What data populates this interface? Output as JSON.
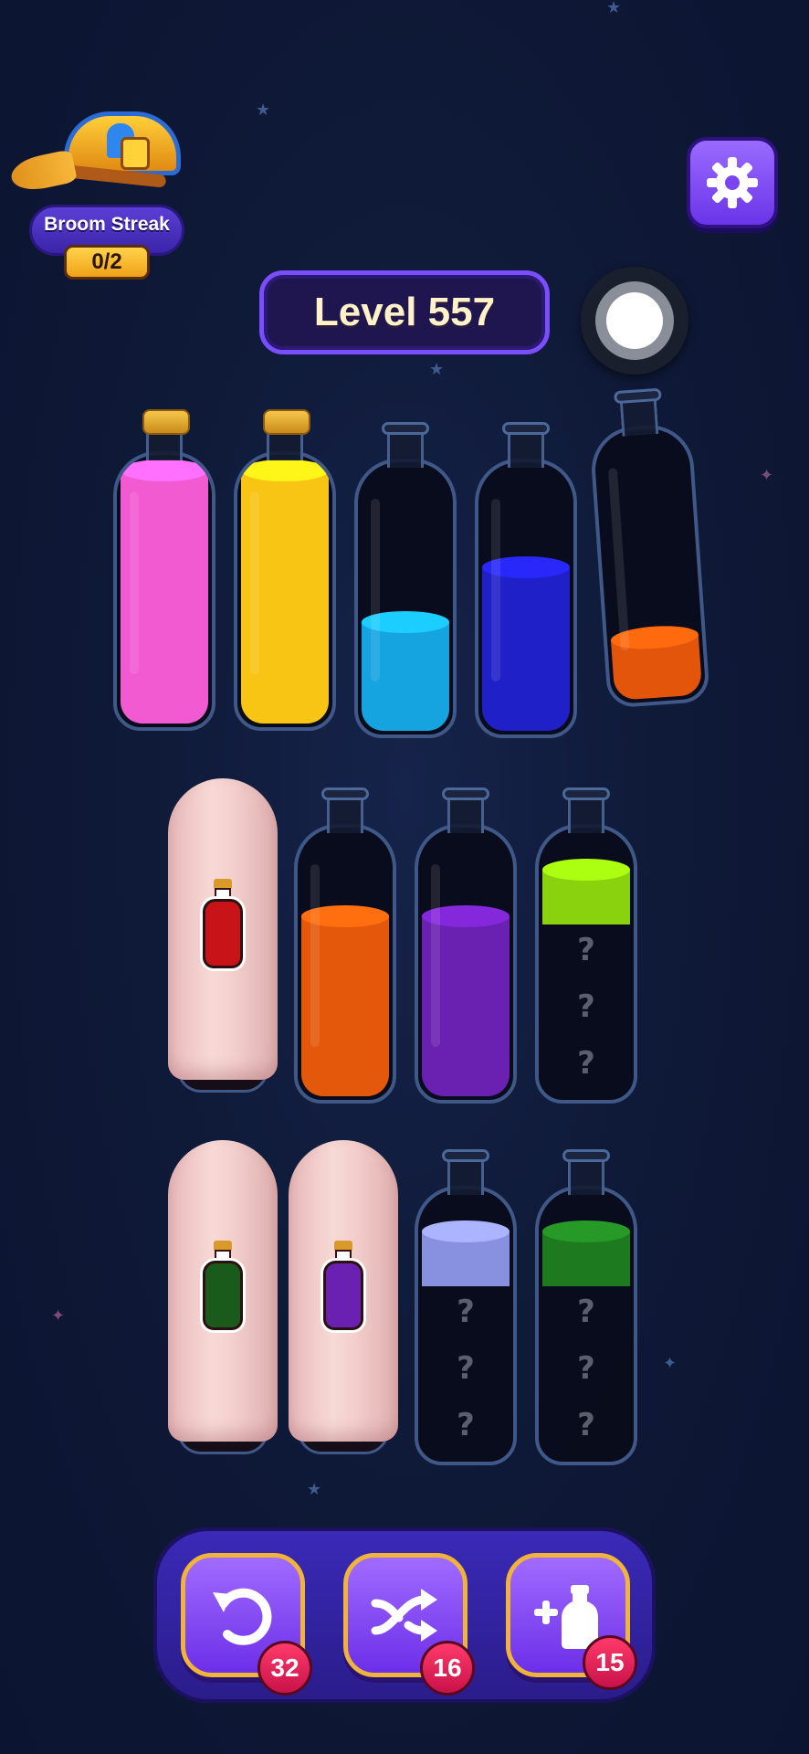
{
  "streak": {
    "label": "Broom Streak",
    "count": "0/2"
  },
  "level": {
    "label": "Level 557"
  },
  "icons": {
    "settings": "gear-icon",
    "record": "record-button",
    "undo": "undo-icon",
    "shuffle": "shuffle-icon",
    "add_bottle": "add-bottle-icon"
  },
  "bottles_row1": [
    {
      "color": "#f25ad2",
      "level": 0.93,
      "corked": true
    },
    {
      "color": "#f9c514",
      "level": 0.93,
      "corked": true
    },
    {
      "color": "#16a4e0",
      "level": 0.4,
      "corked": false
    },
    {
      "color": "#2020c8",
      "level": 0.6,
      "corked": false
    },
    {
      "color": "#e4550c",
      "level": 0.2,
      "corked": false
    }
  ],
  "bottles_row2": [
    {
      "covered": true,
      "hint_color": "#c81418"
    },
    {
      "color": "#e4580c",
      "level": 0.66,
      "corked": false
    },
    {
      "color": "#6a20b0",
      "level": 0.66,
      "corked": false
    },
    {
      "color": "#8ad20e",
      "level": 0.26,
      "corked": false,
      "hidden_marks": [
        "?",
        "?",
        "?"
      ]
    }
  ],
  "bottles_row3": [
    {
      "covered": true,
      "hint_color": "#1a5a1a"
    },
    {
      "covered": true,
      "hint_color": "#6a20b0"
    },
    {
      "color": "#8890e0",
      "level": 0.26,
      "corked": false,
      "hidden_marks": [
        "?",
        "?",
        "?"
      ]
    },
    {
      "color": "#1e7a1e",
      "level": 0.26,
      "corked": false,
      "hidden_marks": [
        "?",
        "?",
        "?"
      ]
    }
  ],
  "tools": {
    "undo_count": "32",
    "shuffle_count": "16",
    "add_bottle_count": "15"
  }
}
